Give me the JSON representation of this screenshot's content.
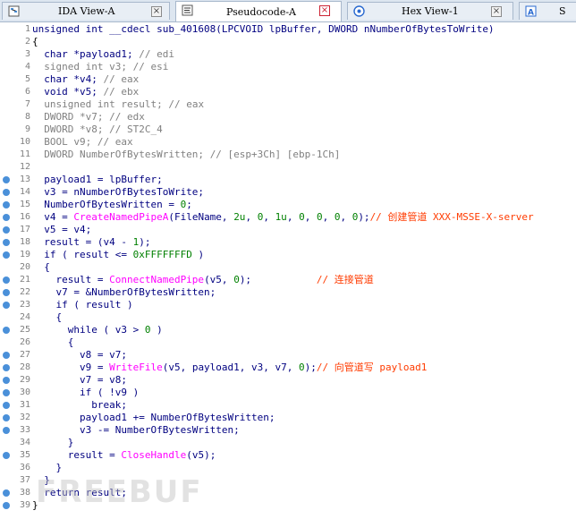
{
  "tabs": [
    {
      "label": "IDA View-A",
      "active": false
    },
    {
      "label": "Pseudocode-A",
      "active": true
    },
    {
      "label": "Hex View-1",
      "active": false
    },
    {
      "label": "S",
      "active": false
    }
  ],
  "colors": {
    "accent": "#4a90d9",
    "function": "#ff00ff",
    "number": "#008000",
    "comment": "#808080",
    "keyword": "#000080",
    "chinese_comment": "#ff3b00"
  },
  "watermark": "FREEBUF",
  "lines": [
    {
      "n": "1",
      "dot": false,
      "tokens": [
        [
          "unsigned int __cdecl sub_401608(LPCVOID lpBuffer, DWORD nNumberOfBytesToWrite)",
          "kw"
        ]
      ]
    },
    {
      "n": "2",
      "dot": false,
      "tokens": [
        [
          "{",
          "plain"
        ]
      ]
    },
    {
      "n": "3",
      "dot": false,
      "tokens": [
        [
          "  char *payload1; ",
          "kw"
        ],
        [
          "// edi",
          "cm"
        ]
      ]
    },
    {
      "n": "4",
      "dot": false,
      "tokens": [
        [
          "  signed int v3; ",
          "cm"
        ],
        [
          "// esi",
          "cm"
        ]
      ]
    },
    {
      "n": "5",
      "dot": false,
      "tokens": [
        [
          "  char *v4; ",
          "kw"
        ],
        [
          "// eax",
          "cm"
        ]
      ]
    },
    {
      "n": "6",
      "dot": false,
      "tokens": [
        [
          "  void *v5; ",
          "kw"
        ],
        [
          "// ebx",
          "cm"
        ]
      ]
    },
    {
      "n": "7",
      "dot": false,
      "tokens": [
        [
          "  unsigned int result; ",
          "cm"
        ],
        [
          "// eax",
          "cm"
        ]
      ]
    },
    {
      "n": "8",
      "dot": false,
      "tokens": [
        [
          "  DWORD *v7; ",
          "cm"
        ],
        [
          "// edx",
          "cm"
        ]
      ]
    },
    {
      "n": "9",
      "dot": false,
      "tokens": [
        [
          "  DWORD *v8; ",
          "cm"
        ],
        [
          "// ST2C_4",
          "cm"
        ]
      ]
    },
    {
      "n": "10",
      "dot": false,
      "tokens": [
        [
          "  BOOL v9; ",
          "cm"
        ],
        [
          "// eax",
          "cm"
        ]
      ]
    },
    {
      "n": "11",
      "dot": false,
      "tokens": [
        [
          "  DWORD NumberOfBytesWritten; ",
          "cm"
        ],
        [
          "// [esp+3Ch] [ebp-1Ch]",
          "cm"
        ]
      ]
    },
    {
      "n": "12",
      "dot": false,
      "tokens": []
    },
    {
      "n": "13",
      "dot": true,
      "tokens": [
        [
          "  payload1 = lpBuffer;",
          "kw"
        ]
      ]
    },
    {
      "n": "14",
      "dot": true,
      "tokens": [
        [
          "  v3 = nNumberOfBytesToWrite;",
          "kw"
        ]
      ]
    },
    {
      "n": "15",
      "dot": true,
      "tokens": [
        [
          "  NumberOfBytesWritten = ",
          "kw"
        ],
        [
          "0",
          "num"
        ],
        [
          ";",
          "kw"
        ]
      ]
    },
    {
      "n": "16",
      "dot": true,
      "tokens": [
        [
          "  v4 = ",
          "kw"
        ],
        [
          "CreateNamedPipeA",
          "fn"
        ],
        [
          "(FileName, ",
          "kw"
        ],
        [
          "2u",
          "num"
        ],
        [
          ", ",
          "kw"
        ],
        [
          "0",
          "num"
        ],
        [
          ", ",
          "kw"
        ],
        [
          "1u",
          "num"
        ],
        [
          ", ",
          "kw"
        ],
        [
          "0",
          "num"
        ],
        [
          ", ",
          "kw"
        ],
        [
          "0",
          "num"
        ],
        [
          ", ",
          "kw"
        ],
        [
          "0",
          "num"
        ],
        [
          ", ",
          "kw"
        ],
        [
          "0",
          "num"
        ],
        [
          ");",
          "kw"
        ],
        [
          "// 创建管道 XXX-MSSE-X-server",
          "cn"
        ]
      ]
    },
    {
      "n": "17",
      "dot": true,
      "tokens": [
        [
          "  v5 = v4;",
          "kw"
        ]
      ]
    },
    {
      "n": "18",
      "dot": true,
      "tokens": [
        [
          "  result = (v4 - ",
          "kw"
        ],
        [
          "1",
          "num"
        ],
        [
          ");",
          "kw"
        ]
      ]
    },
    {
      "n": "19",
      "dot": true,
      "tokens": [
        [
          "  if ( result <= ",
          "kw"
        ],
        [
          "0xFFFFFFFD",
          "num"
        ],
        [
          " )",
          "kw"
        ]
      ]
    },
    {
      "n": "20",
      "dot": false,
      "tokens": [
        [
          "  {",
          "kw"
        ]
      ]
    },
    {
      "n": "21",
      "dot": true,
      "tokens": [
        [
          "    result = ",
          "kw"
        ],
        [
          "ConnectNamedPipe",
          "fn"
        ],
        [
          "(v5, ",
          "kw"
        ],
        [
          "0",
          "num"
        ],
        [
          ");",
          "kw"
        ],
        [
          "           // 连接管道",
          "cn"
        ]
      ]
    },
    {
      "n": "22",
      "dot": true,
      "tokens": [
        [
          "    v7 = &NumberOfBytesWritten;",
          "kw"
        ]
      ]
    },
    {
      "n": "23",
      "dot": true,
      "tokens": [
        [
          "    if ( result )",
          "kw"
        ]
      ]
    },
    {
      "n": "24",
      "dot": false,
      "tokens": [
        [
          "    {",
          "kw"
        ]
      ]
    },
    {
      "n": "25",
      "dot": true,
      "tokens": [
        [
          "      while ( v3 > ",
          "kw"
        ],
        [
          "0",
          "num"
        ],
        [
          " )",
          "kw"
        ]
      ]
    },
    {
      "n": "26",
      "dot": false,
      "tokens": [
        [
          "      {",
          "kw"
        ]
      ]
    },
    {
      "n": "27",
      "dot": true,
      "tokens": [
        [
          "        v8 = v7;",
          "kw"
        ]
      ]
    },
    {
      "n": "28",
      "dot": true,
      "tokens": [
        [
          "        v9 = ",
          "kw"
        ],
        [
          "WriteFile",
          "fn"
        ],
        [
          "(v5, payload1, v3, v7, ",
          "kw"
        ],
        [
          "0",
          "num"
        ],
        [
          ");",
          "kw"
        ],
        [
          "// 向管道写 payload1",
          "cn"
        ]
      ]
    },
    {
      "n": "29",
      "dot": true,
      "tokens": [
        [
          "        v7 = v8;",
          "kw"
        ]
      ]
    },
    {
      "n": "30",
      "dot": true,
      "tokens": [
        [
          "        if ( !v9 )",
          "kw"
        ]
      ]
    },
    {
      "n": "31",
      "dot": true,
      "tokens": [
        [
          "          break;",
          "kw"
        ]
      ]
    },
    {
      "n": "32",
      "dot": true,
      "tokens": [
        [
          "        payload1 += NumberOfBytesWritten;",
          "kw"
        ]
      ]
    },
    {
      "n": "33",
      "dot": true,
      "tokens": [
        [
          "        v3 -= NumberOfBytesWritten;",
          "kw"
        ]
      ]
    },
    {
      "n": "34",
      "dot": false,
      "tokens": [
        [
          "      }",
          "kw"
        ]
      ]
    },
    {
      "n": "35",
      "dot": true,
      "tokens": [
        [
          "      result = ",
          "kw"
        ],
        [
          "CloseHandle",
          "fn"
        ],
        [
          "(v5);",
          "kw"
        ]
      ]
    },
    {
      "n": "36",
      "dot": false,
      "tokens": [
        [
          "    }",
          "kw"
        ]
      ]
    },
    {
      "n": "37",
      "dot": false,
      "tokens": [
        [
          "  }",
          "kw"
        ]
      ]
    },
    {
      "n": "38",
      "dot": true,
      "tokens": [
        [
          "  return result;",
          "kw"
        ]
      ]
    },
    {
      "n": "39",
      "dot": true,
      "tokens": [
        [
          "}",
          "plain"
        ]
      ]
    }
  ]
}
